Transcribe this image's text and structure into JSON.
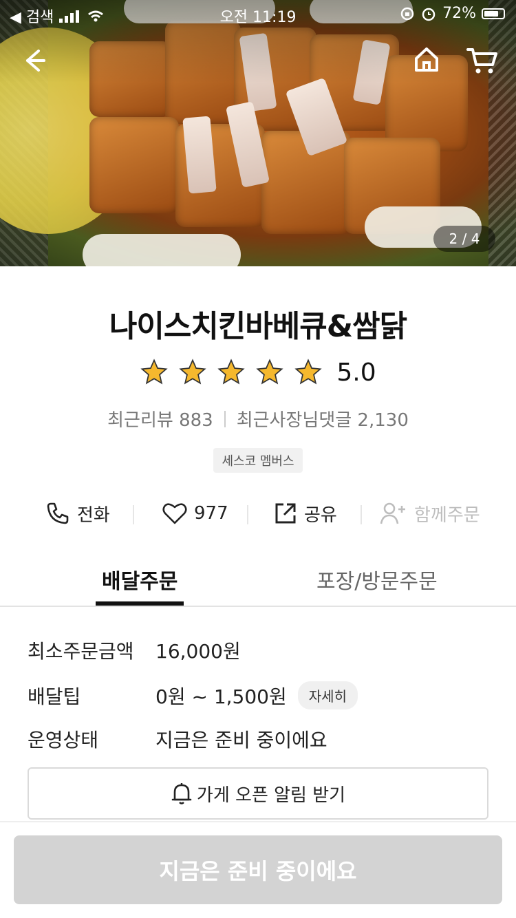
{
  "status_bar": {
    "back_app": "◀ 검색",
    "time": "오전 11:19",
    "battery": "72%"
  },
  "hero": {
    "page_indicator": "2 / 4"
  },
  "store": {
    "name": "나이스치킨바베큐&쌈닭",
    "rating_value": 5.0,
    "rating_text": "5.0",
    "recent_reviews": "최근리뷰 883",
    "owner_replies": "최근사장님댓글 2,130",
    "member_badge": "세스코 멤버스"
  },
  "actions": {
    "call": "전화",
    "likes": "977",
    "share": "공유",
    "group_order": "함께주문"
  },
  "tabs": {
    "delivery": "배달주문",
    "pickup": "포장/방문주문"
  },
  "info": {
    "min_order_label": "최소주문금액",
    "min_order_value": "16,000원",
    "delivery_tip_label": "배달팁",
    "delivery_tip_value": "0원 ~ 1,500원",
    "detail_button": "자세히",
    "status_label": "운영상태",
    "status_value": "지금은 준비 중이에요"
  },
  "notify_button": "가게 오픈 알림 받기",
  "cta_button": "지금은 준비 중이에요",
  "colors": {
    "status_red": "#e8433f",
    "star_fill": "#f5b82e",
    "cta_disabled": "#d3d3d3"
  }
}
